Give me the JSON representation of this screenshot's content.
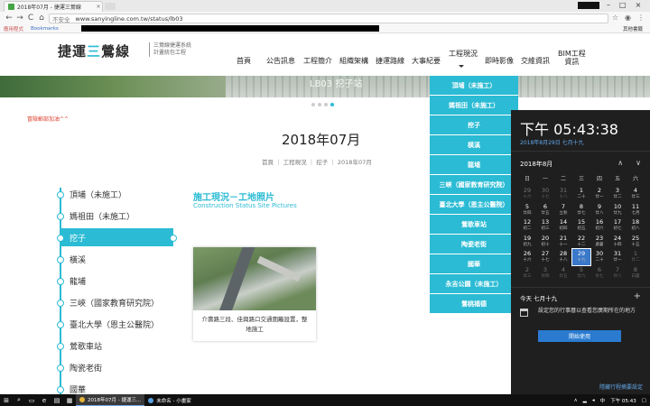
{
  "browser": {
    "tab_title": "2018年07月 - 捷運三鶯線",
    "tab_close": "×",
    "security": "不安全",
    "url": "www.sanyingline.com.tw/status/lb03",
    "nav_back": "←",
    "nav_forward": "→",
    "nav_reload": "C",
    "nav_home": "⌂",
    "bookmarks": [
      "應用程式",
      "Bookmarks"
    ],
    "bookmarks_other": "其他書籤",
    "win_min": "–",
    "win_max": "□",
    "win_close": "×"
  },
  "site": {
    "logo_main_left": "捷運",
    "logo_main_mid": "三",
    "logo_main_right": "鶯線",
    "logo_sub_1": "三鶯線捷運系統",
    "logo_sub_2": "計畫統包工程",
    "nav": [
      "首頁",
      "公告訊息",
      "工程簡介",
      "組織架構",
      "捷運路線",
      "大事紀要",
      "工程現況",
      "即時影像",
      "交維資訊"
    ],
    "nav_bim_1": "BIM工程",
    "nav_bim_2": "資訊",
    "banner_text": "LB03 挖子站",
    "notice": "冒險郵部加油^^",
    "page_title": "2018年07月",
    "breadcrumb": "首頁 ｜ 工程現況 ｜ 挖子 ｜ 2018年07月"
  },
  "sidebar": {
    "items": [
      "頂埔（未施工）",
      "媽祖田（未施工）",
      "挖子",
      "橫溪",
      "龍埔",
      "三峽（國家教育研究院）",
      "臺北大學（恩主公醫院）",
      "鶯歌車站",
      "陶瓷老街",
      "國華"
    ],
    "active_index": 2
  },
  "section": {
    "title": "施工現況－工地照片",
    "subtitle": "Construction Status Site Pictures",
    "photo_caption_1": "介壽路三段、佳興路口交通圍籬設置，整",
    "photo_caption_2": "地施工"
  },
  "dropdown": {
    "items": [
      "頂埔（未施工）",
      "媽祖田（未施工）",
      "挖子",
      "橫溪",
      "龍埔",
      "三峽（國家教育研究院）",
      "臺北大學（恩主公醫院）",
      "鶯歌車站",
      "陶瓷老街",
      "國華",
      "永吉公園（未施工）",
      "鶯桃福德"
    ]
  },
  "calendar": {
    "clock": "下午 05:43:38",
    "date": "2018年8月29日 七月十九",
    "month": "2018年8月",
    "weekdays": [
      "日",
      "一",
      "二",
      "三",
      "四",
      "五",
      "六"
    ],
    "days": [
      {
        "d": "29",
        "l": "十六",
        "dim": true
      },
      {
        "d": "30",
        "l": "十七",
        "dim": true
      },
      {
        "d": "31",
        "l": "十八",
        "dim": true
      },
      {
        "d": "1",
        "l": "二十"
      },
      {
        "d": "2",
        "l": "廿一"
      },
      {
        "d": "3",
        "l": "廿二"
      },
      {
        "d": "4",
        "l": "廿三"
      },
      {
        "d": "5",
        "l": "廿四"
      },
      {
        "d": "6",
        "l": "廿五"
      },
      {
        "d": "7",
        "l": "立秋"
      },
      {
        "d": "8",
        "l": "廿七"
      },
      {
        "d": "9",
        "l": "廿八"
      },
      {
        "d": "10",
        "l": "廿九"
      },
      {
        "d": "11",
        "l": "七月"
      },
      {
        "d": "12",
        "l": "初二"
      },
      {
        "d": "13",
        "l": "初三"
      },
      {
        "d": "14",
        "l": "初四"
      },
      {
        "d": "15",
        "l": "初五"
      },
      {
        "d": "16",
        "l": "初六"
      },
      {
        "d": "17",
        "l": "初七"
      },
      {
        "d": "18",
        "l": "初八"
      },
      {
        "d": "19",
        "l": "初九"
      },
      {
        "d": "20",
        "l": "初十"
      },
      {
        "d": "21",
        "l": "十一"
      },
      {
        "d": "22",
        "l": "十二"
      },
      {
        "d": "23",
        "l": "處暑"
      },
      {
        "d": "24",
        "l": "十四"
      },
      {
        "d": "25",
        "l": "十五"
      },
      {
        "d": "26",
        "l": "十六"
      },
      {
        "d": "27",
        "l": "十七"
      },
      {
        "d": "28",
        "l": "十八"
      },
      {
        "d": "29",
        "l": "十九",
        "today": true
      },
      {
        "d": "30",
        "l": "二十"
      },
      {
        "d": "31",
        "l": "廿一"
      },
      {
        "d": "1",
        "l": "廿二",
        "dim": true
      },
      {
        "d": "2",
        "l": "廿三",
        "dim": true
      },
      {
        "d": "3",
        "l": "廿四",
        "dim": true
      },
      {
        "d": "4",
        "l": "廿五",
        "dim": true
      },
      {
        "d": "5",
        "l": "廿六",
        "dim": true
      },
      {
        "d": "6",
        "l": "廿七",
        "dim": true
      },
      {
        "d": "7",
        "l": "廿八",
        "dim": true
      },
      {
        "d": "8",
        "l": "白露",
        "dim": true
      }
    ],
    "today_label": "今天 七月十九",
    "agenda_text": "設定您的行事曆以查看您廣期所在的地方",
    "start_button": "開始使用",
    "hide_link": "隱藏行程摘要設定",
    "arrow_up": "∧",
    "arrow_down": "∨",
    "plus": "+"
  },
  "taskbar": {
    "apps": [
      "2018年07月 - 捷運三...",
      "未命名 - 小畫家"
    ],
    "lang": "中",
    "time": "下午 05:43"
  },
  "colors": {
    "accent": "#2bbbd4",
    "calendar_bg": "#1f1f1f",
    "today": "#3a78c9",
    "notice": "#dd4433"
  }
}
